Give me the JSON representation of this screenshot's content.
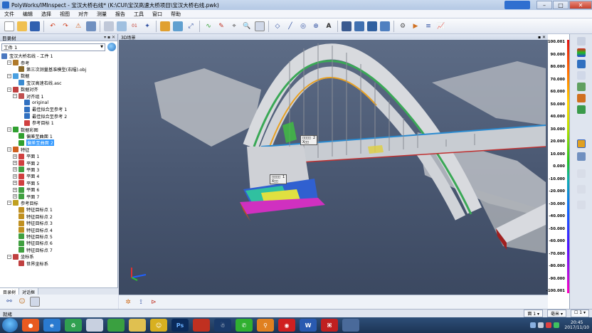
{
  "window": {
    "title": "PolyWorks/IMInspect - 宝汉大桥右线* (K:\\CUI\\宝汉高速大桥项目\\宝汉大桥右线.pwk)",
    "help_label": "帮助"
  },
  "menu": [
    "文件",
    "编辑",
    "选择",
    "视图",
    "对齐",
    "测量",
    "报告",
    "工具",
    "窗口",
    "帮助"
  ],
  "tree_panel": {
    "header": "目录树",
    "header_controls": "▾ ▪ ✕",
    "workspace_combo": "工件 1",
    "root": "宝汉大桥右线 - 工件 1",
    "rows": [
      {
        "label": "参考",
        "indent": 1,
        "exp": "−",
        "color": "#b07a2a"
      },
      {
        "label": "第三次测量基准模型(右幅).obj",
        "indent": 2,
        "exp": "",
        "color": "#8a6a2a"
      },
      {
        "label": "数据",
        "indent": 1,
        "exp": "−",
        "color": "#4aa0e0"
      },
      {
        "label": "宝汉高速右线.asc",
        "indent": 2,
        "exp": "",
        "color": "#3a8ad0"
      },
      {
        "label": "数据对齐",
        "indent": 1,
        "exp": "−",
        "color": "#c04040"
      },
      {
        "label": "对齐组 1",
        "indent": 2,
        "exp": "−",
        "color": "#c05050"
      },
      {
        "label": "original",
        "indent": 3,
        "exp": "",
        "color": "#3070c0"
      },
      {
        "label": "最佳拟合至参考 1",
        "indent": 3,
        "exp": "",
        "color": "#3070c0"
      },
      {
        "label": "最佳拟合至参考 2",
        "indent": 3,
        "exp": "",
        "color": "#3070c0"
      },
      {
        "label": "参考目标 1",
        "indent": 3,
        "exp": "",
        "color": "#d04040"
      },
      {
        "label": "数据彩图",
        "indent": 1,
        "exp": "−",
        "color": "#30a030"
      },
      {
        "label": "偏差至曲面 1",
        "indent": 2,
        "exp": "",
        "color": "#30a030"
      },
      {
        "label": "偏差至曲面 2",
        "indent": 2,
        "exp": "",
        "color": "#30a030",
        "selected": true
      },
      {
        "label": "特征",
        "indent": 1,
        "exp": "−",
        "color": "#d06020"
      },
      {
        "label": "平面 1",
        "indent": 2,
        "exp": "+",
        "color": "#d04040"
      },
      {
        "label": "平面 2",
        "indent": 2,
        "exp": "+",
        "color": "#d04040"
      },
      {
        "label": "平面 3",
        "indent": 2,
        "exp": "+",
        "color": "#40a040"
      },
      {
        "label": "平面 4",
        "indent": 2,
        "exp": "+",
        "color": "#d04040"
      },
      {
        "label": "平面 5",
        "indent": 2,
        "exp": "+",
        "color": "#d04040"
      },
      {
        "label": "平面 6",
        "indent": 2,
        "exp": "+",
        "color": "#40a040"
      },
      {
        "label": "平面 7",
        "indent": 2,
        "exp": "+",
        "color": "#40a040"
      },
      {
        "label": "参考目标",
        "indent": 1,
        "exp": "−",
        "color": "#c0a020"
      },
      {
        "label": "特征目标点 1",
        "indent": 2,
        "exp": "",
        "color": "#c09020"
      },
      {
        "label": "特征目标点 2",
        "indent": 2,
        "exp": "",
        "color": "#c09020"
      },
      {
        "label": "特征目标点 3",
        "indent": 2,
        "exp": "",
        "color": "#c09020"
      },
      {
        "label": "特征目标点 4",
        "indent": 2,
        "exp": "",
        "color": "#c09020"
      },
      {
        "label": "特征目标点 5",
        "indent": 2,
        "exp": "",
        "color": "#40a040"
      },
      {
        "label": "特征目标点 6",
        "indent": 2,
        "exp": "",
        "color": "#40a040"
      },
      {
        "label": "特征目标点 7",
        "indent": 2,
        "exp": "",
        "color": "#40a040"
      },
      {
        "label": "坐标系",
        "indent": 1,
        "exp": "−",
        "color": "#c04040"
      },
      {
        "label": "世界坐标系",
        "indent": 2,
        "exp": "",
        "color": "#c04040"
      }
    ],
    "tabs": [
      "目录树",
      "对话框"
    ]
  },
  "viewport": {
    "title": "3D场景",
    "header_controls": "▪ ✕",
    "labels": [
      {
        "line1": "□□□□ 2",
        "line2": "X□□"
      },
      {
        "line1": "□□□□ 1",
        "line2": "X□□"
      }
    ]
  },
  "scale": {
    "ticks": [
      "100.001",
      "90.000",
      "80.000",
      "70.000",
      "60.000",
      "50.000",
      "40.000",
      "30.000",
      "20.000",
      "10.000",
      "0.000",
      "-10.000",
      "-20.000",
      "-30.000",
      "-40.000",
      "-50.000",
      "-60.000",
      "-70.000",
      "-80.000",
      "-90.000",
      "-100.001"
    ]
  },
  "status": {
    "left": "就绪",
    "field1": "面 1 ▾",
    "field2": "毫米 ▾",
    "field3": "☐ 1 ▾"
  },
  "taskbar": {
    "clock_time": "20:45",
    "clock_date": "2017/11/10"
  },
  "colors": {
    "accent": "#3399ff",
    "viewport_bg": "#4a5872"
  }
}
